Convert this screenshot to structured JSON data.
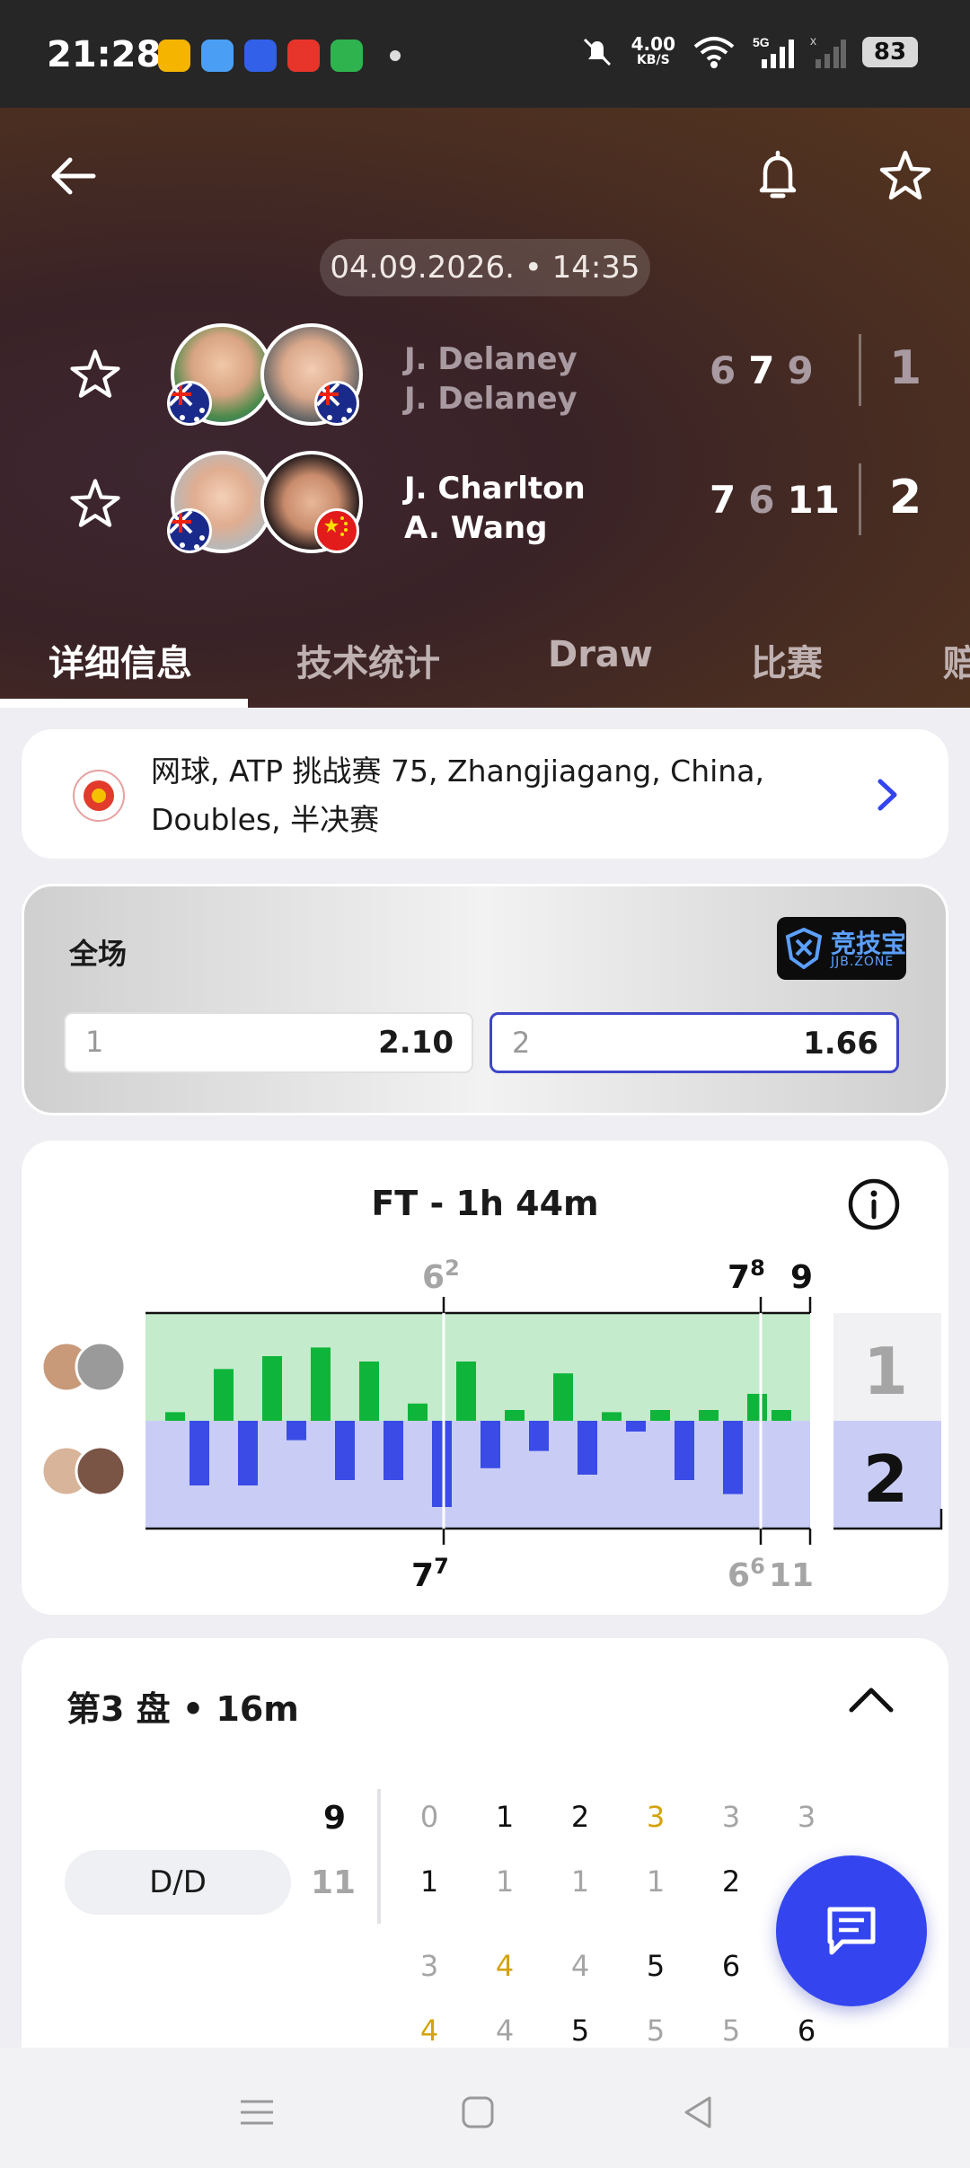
{
  "status": {
    "time": "21:28",
    "net_speed": "4.00",
    "net_unit": "KB/S",
    "network": "5G",
    "battery": "83"
  },
  "match": {
    "date": "04.09.2026. • 14:35",
    "team1": {
      "player1": "J. Delaney",
      "player2": "J. Delaney",
      "sets": [
        "6",
        "7",
        "9"
      ],
      "total": "1"
    },
    "team2": {
      "player1": "J. Charlton",
      "player2": "A. Wang",
      "sets": [
        "7",
        "6",
        "11"
      ],
      "total": "2"
    }
  },
  "tabs": [
    "详细信息",
    "技术统计",
    "Draw",
    "比赛",
    "赔"
  ],
  "tournament": {
    "text": "网球, ATP 挑战赛 75, Zhangjiagang, China, Doubles, 半决赛"
  },
  "odds": {
    "title": "全场",
    "logo_big": "竞技宝",
    "logo_small": "JJB.ZONE",
    "opt1_label": "1",
    "opt1_value": "2.10",
    "opt2_label": "2",
    "opt2_value": "1.66"
  },
  "momentum": {
    "title": "FT - 1h 44m",
    "top_labels": [
      {
        "main": "6",
        "sup": "2"
      },
      {
        "main": "7",
        "sup": "8"
      },
      {
        "main": "9",
        "sup": ""
      }
    ],
    "bottom_labels": [
      {
        "main": "7",
        "sup": "7"
      },
      {
        "main": "6",
        "sup": "6"
      },
      {
        "main": "11",
        "sup": ""
      }
    ],
    "side_top": "1",
    "side_bottom": "2",
    "colors": {
      "team1": "#0fb53a",
      "team1_bg": "#c4ebcb",
      "team2": "#3a4be6",
      "team2_bg": "#c9cdf6"
    },
    "games": [
      {
        "v": 0.08
      },
      {
        "v": -0.6
      },
      {
        "v": 0.48
      },
      {
        "v": -0.6
      },
      {
        "v": 0.6
      },
      {
        "v": -0.18
      },
      {
        "v": 0.68
      },
      {
        "v": -0.55
      },
      {
        "v": 0.55
      },
      {
        "v": -0.55
      },
      {
        "v": 0.16
      },
      {
        "v": -0.8
      },
      {
        "v": 0.55
      },
      {
        "v": -0.44
      },
      {
        "v": 0.1
      },
      {
        "v": -0.28
      },
      {
        "v": 0.44
      },
      {
        "v": -0.5
      },
      {
        "v": 0.08
      },
      {
        "v": -0.1
      },
      {
        "v": 0.1
      },
      {
        "v": -0.55
      },
      {
        "v": 0.1
      },
      {
        "v": -0.68
      },
      {
        "v": 0.25
      },
      {
        "v": 0.1
      }
    ]
  },
  "set_detail": {
    "title": "第3 盘 • 16m",
    "pill": "D/D",
    "score_top": "9",
    "score_bottom": "11",
    "row1_top": [
      "0",
      "1",
      "2",
      "3",
      "3",
      "3"
    ],
    "row1_bottom": [
      "1",
      "1",
      "1",
      "1",
      "2",
      ""
    ],
    "row2_top": [
      "3",
      "4",
      "4",
      "5",
      "6",
      ""
    ],
    "row2_bottom": [
      "4",
      "4",
      "5",
      "5",
      "5",
      "6"
    ]
  }
}
